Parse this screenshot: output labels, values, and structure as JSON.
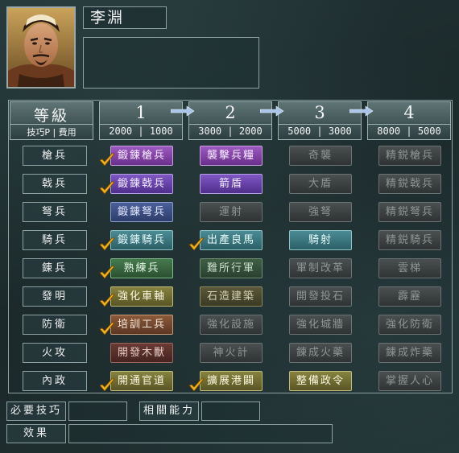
{
  "character": {
    "name": "李淵",
    "portrait_icon": "general-portrait"
  },
  "header": {
    "title": "等級",
    "subtitle_left": "技巧P",
    "subtitle_right": "費用",
    "levels": [
      {
        "num": "1",
        "cost": "2000 | 1000"
      },
      {
        "num": "2",
        "cost": "3000 | 2000"
      },
      {
        "num": "3",
        "cost": "5000 | 3000"
      },
      {
        "num": "4",
        "cost": "8000 | 5000"
      }
    ]
  },
  "rows": [
    {
      "label": "槍兵",
      "techs": [
        "鍛錬槍兵",
        "襲擊兵糧",
        "奇襲",
        "精鋭槍兵"
      ]
    },
    {
      "label": "戟兵",
      "techs": [
        "鍛錬戟兵",
        "箭盾",
        "大盾",
        "精鋭戟兵"
      ]
    },
    {
      "label": "弩兵",
      "techs": [
        "鍛錬弩兵",
        "運射",
        "強弩",
        "精鋭弩兵"
      ]
    },
    {
      "label": "騎兵",
      "techs": [
        "鍛錬騎兵",
        "出產良馬",
        "騎射",
        "精鋭騎兵"
      ]
    },
    {
      "label": "錬兵",
      "techs": [
        "熟練兵",
        "難所行軍",
        "軍制改革",
        "雲梯"
      ]
    },
    {
      "label": "發明",
      "techs": [
        "強化車軸",
        "石造建築",
        "開發投石",
        "霹靂"
      ]
    },
    {
      "label": "防衛",
      "techs": [
        "培訓工兵",
        "強化設施",
        "強化城牆",
        "強化防衛"
      ]
    },
    {
      "label": "火攻",
      "techs": [
        "開發木獸",
        "神火計",
        "錬成火藥",
        "錬成炸藥"
      ]
    },
    {
      "label": "內政",
      "techs": [
        "開通官道",
        "擴展港闢",
        "整備政令",
        "掌握人心"
      ]
    }
  ],
  "footer": {
    "required_label": "必要技巧",
    "required_value": "",
    "related_label": "相關能力",
    "related_value": "",
    "effect_label": "效果",
    "effect_value": ""
  },
  "colors": {
    "checkmark": "#f2b21a",
    "frame": "#8fa2a2"
  }
}
